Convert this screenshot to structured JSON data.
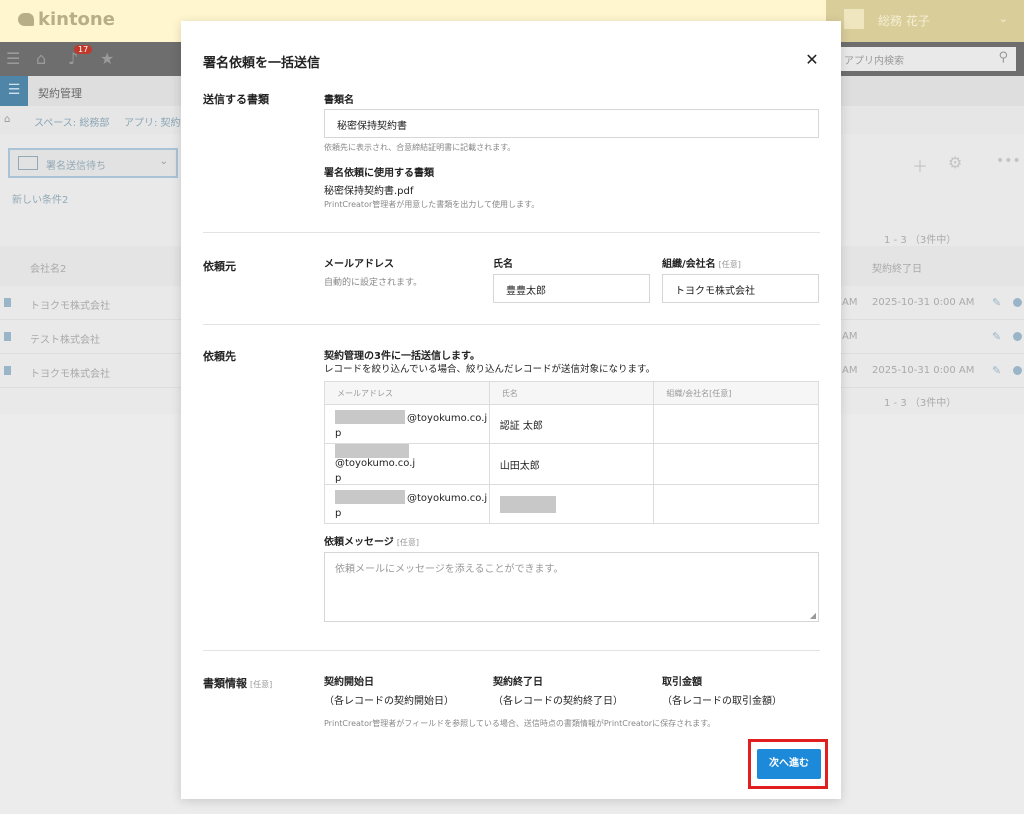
{
  "app": {
    "logo": "kintone",
    "user_name": "総務 花子",
    "notification_count": "17",
    "search_placeholder": "アプリ内検索",
    "app_name": "契約管理",
    "breadcrumbs": [
      "スペース: 総務部",
      "アプリ: 契約管理"
    ],
    "view_name": "署名送信待ち",
    "filter_name": "新しい条件2",
    "pager": "1 - 3 （3件中）",
    "columns": [
      "会社名2",
      "契約終了日"
    ],
    "rows": [
      {
        "company": "トヨクモ株式会社",
        "am": "AM",
        "end_date": "2025-10-31 0:00 AM"
      },
      {
        "company": "テスト株式会社",
        "am": "AM",
        "end_date": ""
      },
      {
        "company": "トヨクモ株式会社",
        "am": "AM",
        "end_date": "2025-10-31 0:00 AM"
      }
    ]
  },
  "modal": {
    "title": "署名依頼を一括送信",
    "section_document": {
      "label": "送信する書類",
      "doc_name_label": "書類名",
      "doc_name_value": "秘密保持契約書",
      "doc_name_help": "依頼先に表示され、合意締結証明書に記載されます。",
      "used_doc_label": "署名依頼に使用する書類",
      "used_doc_value": "秘密保持契約書.pdf",
      "used_doc_help": "PrintCreator管理者が用意した書類を出力して使用します。"
    },
    "section_sender": {
      "label": "依頼元",
      "email_label": "メールアドレス",
      "email_help": "自動的に設定されます。",
      "name_label": "氏名",
      "name_value": "豊豊太郎",
      "org_label": "組織/会社名",
      "org_optional": "[任意]",
      "org_value": "トヨクモ株式会社"
    },
    "section_recipients": {
      "label": "依頼先",
      "note_line1": "契約管理の3件に一括送信します。",
      "note_line2": "レコードを絞り込んでいる場合、絞り込んだレコードが送信対象になります。",
      "columns": [
        "メールアドレス",
        "氏名",
        "組織/会社名[任意]"
      ],
      "rows": [
        {
          "email_domain": "@toyokumo.co.j",
          "email_tail": "p",
          "name": "認証 太郎",
          "org": ""
        },
        {
          "email_domain": "@toyokumo.co.j",
          "email_tail": "p",
          "name": "山田太郎",
          "org": ""
        },
        {
          "email_domain": "@toyokumo.co.j",
          "email_tail": "p",
          "name": "",
          "org": ""
        }
      ],
      "message_label": "依頼メッセージ",
      "message_optional": "[任意]",
      "message_placeholder": "依頼メールにメッセージを添えることができます。"
    },
    "section_info": {
      "label": "書類情報",
      "optional": "[任意]",
      "start_label": "契約開始日",
      "start_value": "（各レコードの契約開始日）",
      "end_label": "契約終了日",
      "end_value": "（各レコードの契約終了日）",
      "amount_label": "取引金額",
      "amount_value": "（各レコードの取引金額）",
      "help": "PrintCreator管理者がフィールドを参照している場合、送信時点の書類情報がPrintCreatorに保存されます。"
    },
    "next_button": "次へ進む",
    "close_icon": "close-icon"
  },
  "colors": {
    "primary_button": "#1c8ad8",
    "highlight_frame": "#e02020"
  }
}
